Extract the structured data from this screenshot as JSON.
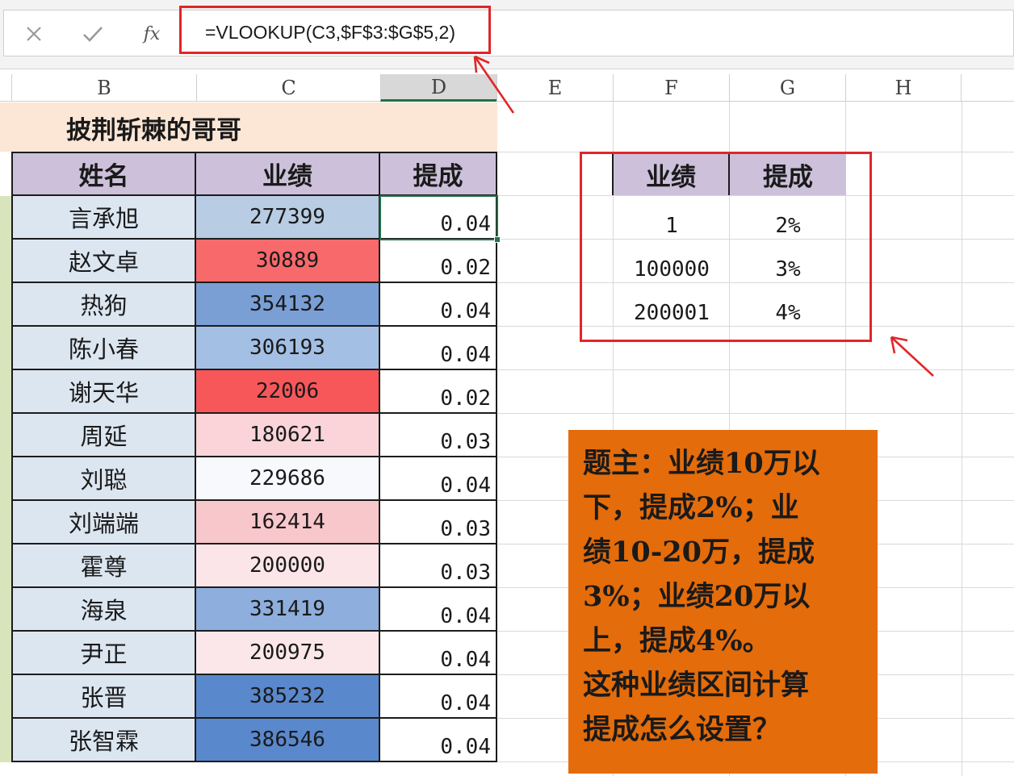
{
  "formula_bar": {
    "cancel_icon": "close-icon",
    "enter_icon": "check-icon",
    "function_label": "fx",
    "formula": "=VLOOKUP(C3,$F$3:$G$5,2)"
  },
  "columns": [
    "B",
    "C",
    "D",
    "E",
    "F",
    "G",
    "H"
  ],
  "selected_column": "D",
  "sheet_title": "披荆斩棘的哥哥",
  "table": {
    "headers": {
      "name": "姓名",
      "performance": "业绩",
      "commission": "提成"
    },
    "rows": [
      {
        "name": "言承旭",
        "performance": "277399",
        "commission": "0.04",
        "color": "#b8cce4"
      },
      {
        "name": "赵文卓",
        "performance": "30889",
        "commission": "0.02",
        "color": "#f8696b"
      },
      {
        "name": "热狗",
        "performance": "354132",
        "commission": "0.04",
        "color": "#7a9fd4"
      },
      {
        "name": "陈小春",
        "performance": "306193",
        "commission": "0.04",
        "color": "#a4bfe4"
      },
      {
        "name": "谢天华",
        "performance": "22006",
        "commission": "0.02",
        "color": "#f8575a"
      },
      {
        "name": "周延",
        "performance": "180621",
        "commission": "0.03",
        "color": "#fad4d8"
      },
      {
        "name": "刘聪",
        "performance": "229686",
        "commission": "0.04",
        "color": "#f8f9fd"
      },
      {
        "name": "刘端端",
        "performance": "162414",
        "commission": "0.03",
        "color": "#f8c7cc"
      },
      {
        "name": "霍尊",
        "performance": "200000",
        "commission": "0.03",
        "color": "#fbe5e9"
      },
      {
        "name": "海泉",
        "performance": "331419",
        "commission": "0.04",
        "color": "#8eaedd"
      },
      {
        "name": "尹正",
        "performance": "200975",
        "commission": "0.04",
        "color": "#fbe7ea"
      },
      {
        "name": "张晋",
        "performance": "385232",
        "commission": "0.04",
        "color": "#5a88cc"
      },
      {
        "name": "张智霖",
        "performance": "386546",
        "commission": "0.04",
        "color": "#5a88cc"
      }
    ]
  },
  "lookup": {
    "headers": {
      "performance": "业绩",
      "commission": "提成"
    },
    "rows": [
      {
        "performance": "1",
        "commission": "2%"
      },
      {
        "performance": "100000",
        "commission": "3%"
      },
      {
        "performance": "200001",
        "commission": "4%"
      }
    ]
  },
  "note": {
    "lines": [
      "题主：业绩10万以",
      "下，提成2%；业",
      "绩10-20万，提成",
      "3%；业绩20万以",
      "上，提成4%。",
      "这种业绩区间计算",
      "提成怎么设置？"
    ]
  },
  "colors": {
    "highlight_red": "#e0262a",
    "header_purple": "#ccc0da",
    "name_blue": "#dce6f1",
    "note_orange": "#e46c0a",
    "title_peach": "#fce6d6",
    "selection_green": "#217346"
  }
}
